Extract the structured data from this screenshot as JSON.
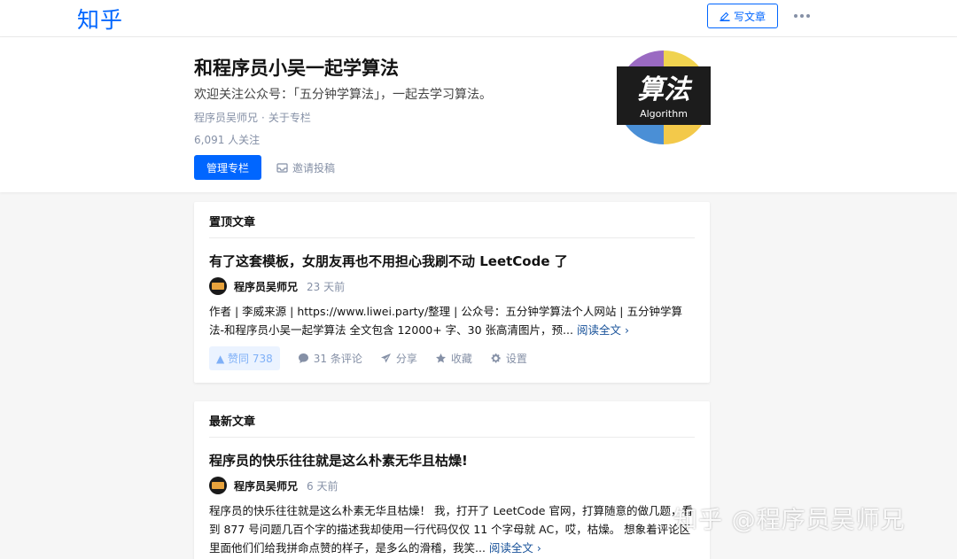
{
  "topbar": {
    "logo": "知乎",
    "write_label": "写文章",
    "more_icon": "more-dots-icon"
  },
  "column": {
    "title": "和程序员小吴一起学算法",
    "description": "欢迎关注公众号：「五分钟学算法」，一起去学习算法。",
    "author": "程序员吴师兄",
    "dot": "·",
    "about": "关于专栏",
    "followers": "6,091 人关注",
    "manage_label": "管理专栏",
    "invite_label": "邀请投稿",
    "avatar_text": "算法",
    "avatar_subtext": "Algorithm"
  },
  "pinned": {
    "header": "置顶文章",
    "title": "有了这套模板，女朋友再也不用担心我刷不动 LeetCode 了",
    "author": "程序员吴师兄",
    "time": "23 天前",
    "excerpt": "作者 | 李威来源 | https://www.liwei.party/整理 | 公众号：五分钟学算法个人网站 | 五分钟学算法-和程序员小吴一起学算法 全文包含 12000+ 字、30 张高清图片，预...",
    "read_more": "阅读全文 ›",
    "vote": "▲ 赞同 738",
    "comments": "31 条评论",
    "share": "分享",
    "favorite": "收藏",
    "settings": "设置"
  },
  "latest": {
    "header": "最新文章",
    "title": "程序员的快乐往往就是这么朴素无华且枯燥!",
    "author": "程序员吴师兄",
    "time": "6 天前",
    "excerpt": "程序员的快乐往往就是这么朴素无华且枯燥！ 我，打开了 LeetCode 官网，打算随意的做几题，看到 877 号问题几百个字的描述我却使用一行代码仅仅 11 个字母就 AC，哎，枯燥。 想象着评论区里面他们们给我拼命点赞的样子，是多么的滑稽，我笑...",
    "read_more": "阅读全文 ›"
  },
  "watermark": "知乎 @程序员吴师兄",
  "colors": {
    "accent": "#0066ff",
    "muted": "#8590a6",
    "link": "#175199"
  }
}
